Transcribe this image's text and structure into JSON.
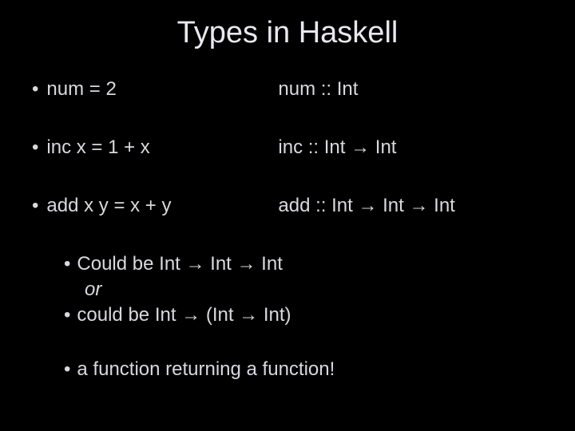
{
  "title": "Types in Haskell",
  "rows": [
    {
      "left": "num = 2",
      "right": "num :: Int"
    },
    {
      "left": "inc x = 1 + x",
      "right": "inc :: Int → Int"
    },
    {
      "left": "add x y = x + y",
      "right": "add :: Int → Int → Int"
    }
  ],
  "sub": {
    "line1": "Could be Int → Int → Int",
    "or": "or",
    "line2": "could be Int → (Int → Int)",
    "line3": "a function returning a function!"
  }
}
